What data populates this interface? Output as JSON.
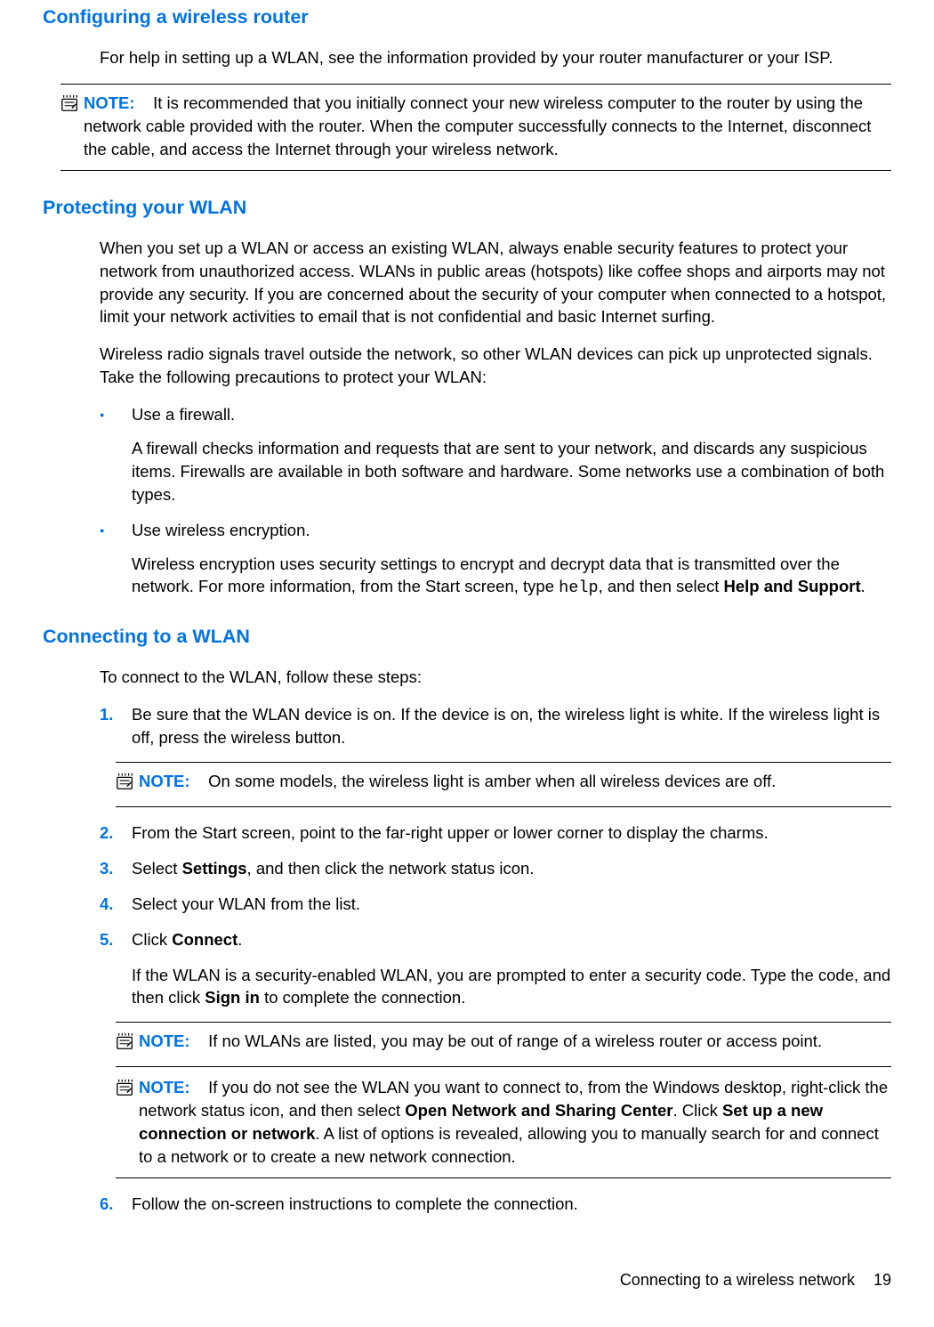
{
  "section1": {
    "title": "Configuring a wireless router",
    "para1": "For help in setting up a WLAN, see the information provided by your router manufacturer or your ISP.",
    "note1_label": "NOTE:",
    "note1_text": "It is recommended that you initially connect your new wireless computer to the router by using the network cable provided with the router. When the computer successfully connects to the Internet, disconnect the cable, and access the Internet through your wireless network."
  },
  "section2": {
    "title": "Protecting your WLAN",
    "para1": "When you set up a WLAN or access an existing WLAN, always enable security features to protect your network from unauthorized access. WLANs in public areas (hotspots) like coffee shops and airports may not provide any security. If you are concerned about the security of your computer when connected to a hotspot, limit your network activities to email that is not confidential and basic Internet surfing.",
    "para2": "Wireless radio signals travel outside the network, so other WLAN devices can pick up unprotected signals. Take the following precautions to protect your WLAN:",
    "bullet1": "Use a firewall.",
    "bullet1_sub": "A firewall checks information and requests that are sent to your network, and discards any suspicious items. Firewalls are available in both software and hardware. Some networks use a combination of both types.",
    "bullet2": "Use wireless encryption.",
    "bullet2_sub_pre": "Wireless encryption uses security settings to encrypt and decrypt data that is transmitted over the network. For more information, from the Start screen, type ",
    "bullet2_mono": "help",
    "bullet2_sub_mid": ", and then select ",
    "bullet2_bold": "Help and Support",
    "bullet2_sub_end": "."
  },
  "section3": {
    "title": "Connecting to a WLAN",
    "para1": "To connect to the WLAN, follow these steps:",
    "step1_num": "1.",
    "step1": "Be sure that the WLAN device is on. If the device is on, the wireless light is white. If the wireless light is off, press the wireless button.",
    "note2_label": "NOTE:",
    "note2_text": "On some models, the wireless light is amber when all wireless devices are off.",
    "step2_num": "2.",
    "step2": "From the Start screen, point to the far-right upper or lower corner to display the charms.",
    "step3_num": "3.",
    "step3_pre": "Select ",
    "step3_bold": "Settings",
    "step3_post": ", and then click the network status icon.",
    "step4_num": "4.",
    "step4": "Select your WLAN from the list.",
    "step5_num": "5.",
    "step5_pre": "Click ",
    "step5_bold": "Connect",
    "step5_post": ".",
    "step5_sub_pre": "If the WLAN is a security-enabled WLAN, you are prompted to enter a security code. Type the code, and then click ",
    "step5_sub_bold": "Sign in",
    "step5_sub_post": " to complete the connection.",
    "note3_label": "NOTE:",
    "note3_text": "If no WLANs are listed, you may be out of range of a wireless router or access point.",
    "note4_label": "NOTE:",
    "note4_pre": "If you do not see the WLAN you want to connect to, from the Windows desktop, right-click the network status icon, and then select ",
    "note4_bold1": "Open Network and Sharing Center",
    "note4_mid1": ". Click ",
    "note4_bold2": "Set up a new connection or network",
    "note4_post": ". A list of options is revealed, allowing you to manually search for and connect to a network or to create a new network connection.",
    "step6_num": "6.",
    "step6": "Follow the on-screen instructions to complete the connection."
  },
  "footer": {
    "text": "Connecting to a wireless network",
    "page": "19"
  }
}
